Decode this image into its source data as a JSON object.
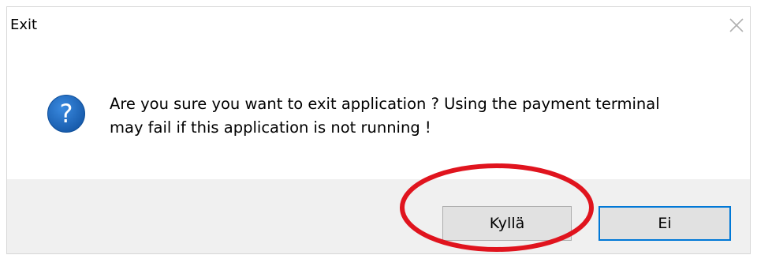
{
  "window": {
    "title": "Exit"
  },
  "message": {
    "text": "Are you sure you want to exit application ? Using the payment terminal may fail if this application is not running !",
    "line1": "Are you sure you want to exit application ? Using the payment terminal",
    "line2": "may fail if this application is not running !"
  },
  "buttons": {
    "yes_label": "Kyllä",
    "no_label": "Ei"
  },
  "icons": {
    "dialog": "question-icon",
    "close": "close-icon"
  },
  "colors": {
    "question_icon_fill": "#1e6ec0",
    "focus_border": "#0078d7",
    "annotation_red": "#e0141e",
    "footer_bg": "#f0f0f0",
    "button_bg": "#e1e1e1"
  }
}
